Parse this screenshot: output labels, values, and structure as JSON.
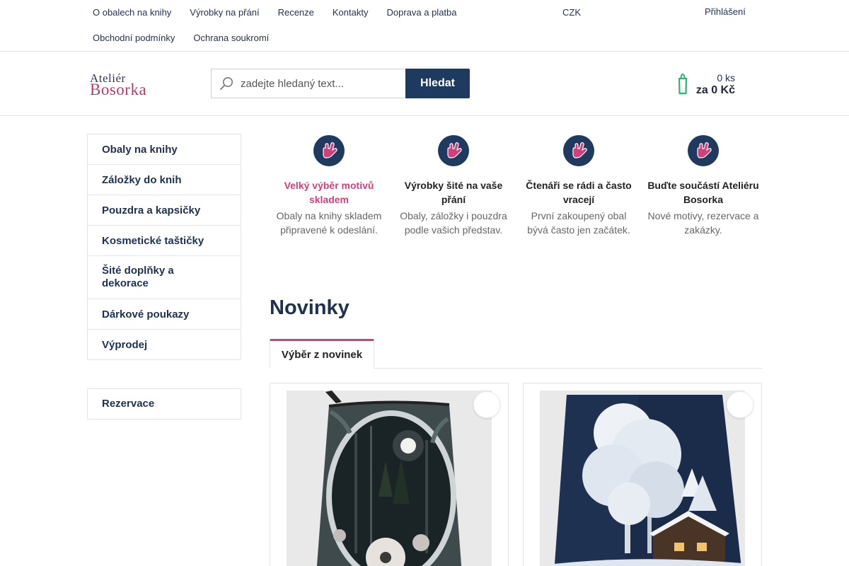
{
  "top_links": [
    "O obalech na knihy",
    "Výrobky na přání",
    "Recenze",
    "Kontakty",
    "Doprava a platba",
    "Obchodní podmínky",
    "Ochrana soukromí"
  ],
  "currency": {
    "label": "CZK",
    "icon": "flag-icon",
    "chevron": ""
  },
  "account": {
    "login_label": "Přihlášení",
    "icon_a": "",
    "icon_b": ""
  },
  "logo": {
    "line1": "Ateliér",
    "line2": "Bosorka"
  },
  "search": {
    "placeholder": "zadejte hledaný text...",
    "button_label": "Hledat"
  },
  "cart": {
    "count": "0 ks",
    "total": "za 0 Kč",
    "icon": "cart-icon",
    "color": "#2bb673"
  },
  "sidebar": {
    "items": [
      {
        "label": "Obaly na knihy",
        "chevron": ""
      },
      {
        "label": "Záložky do knih",
        "chevron": ""
      },
      {
        "label": "Pouzdra a kapsičky",
        "chevron": ""
      },
      {
        "label": "Kosmetické taštičky",
        "chevron": ""
      },
      {
        "label": "Šité doplňky a dekorace",
        "chevron": ""
      },
      {
        "label": "Dárkové poukazy",
        "chevron": ""
      },
      {
        "label": "Výprodej",
        "chevron": ""
      }
    ],
    "extra": "Rezervace"
  },
  "benefits": [
    {
      "title": "Velký výběr motivů skladem",
      "text": "Obaly na knihy skladem připravené k odeslání.",
      "icon": "hand-icon"
    },
    {
      "title": "Výrobky šité na vaše přání",
      "text": "Obaly, záložky i pouzdra podle vašich představ.",
      "icon": "hand-icon"
    },
    {
      "title": "Čtenáři se rádi a často vracejí",
      "text": "První zakoupený obal bývá často jen začátek.",
      "icon": "hand-icon"
    },
    {
      "title": "Buďte součástí Ateliéru Bosorka",
      "text": "Nové motivy, rezervace a zakázky.",
      "icon": "hand-icon"
    }
  ],
  "section": {
    "title": "Novinky",
    "tab": "Výběr z novinek"
  },
  "products": [
    {
      "image": "moonlit-forest-pouch",
      "fav_icon": ""
    },
    {
      "image": "winter-birch-book-cover",
      "fav_icon": ""
    }
  ],
  "colors": {
    "navy": "#1f3a5f",
    "pink": "#d23f7a",
    "benefit_circle": "#1f3a5f"
  }
}
